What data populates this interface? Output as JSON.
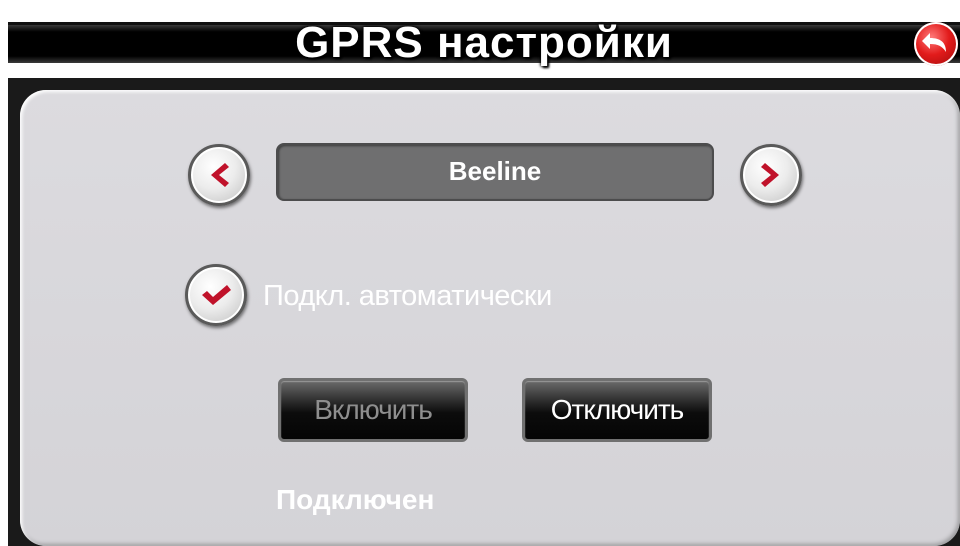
{
  "header": {
    "title": "GPRS настройки",
    "back_icon": "back-arrow-icon"
  },
  "profile": {
    "value": "Beeline",
    "prev_icon": "chevron-left-icon",
    "next_icon": "chevron-right-icon"
  },
  "auto_connect": {
    "label": "Подкл. автоматически",
    "checked": true,
    "icon": "checkmark-icon"
  },
  "actions": {
    "enable_label": "Включить",
    "enable_disabled": true,
    "disable_label": "Отключить"
  },
  "status": {
    "text": "Подключен"
  },
  "colors": {
    "accent": "#c0122a",
    "panel": "#d6d5d9",
    "title_bar": "#000000"
  }
}
